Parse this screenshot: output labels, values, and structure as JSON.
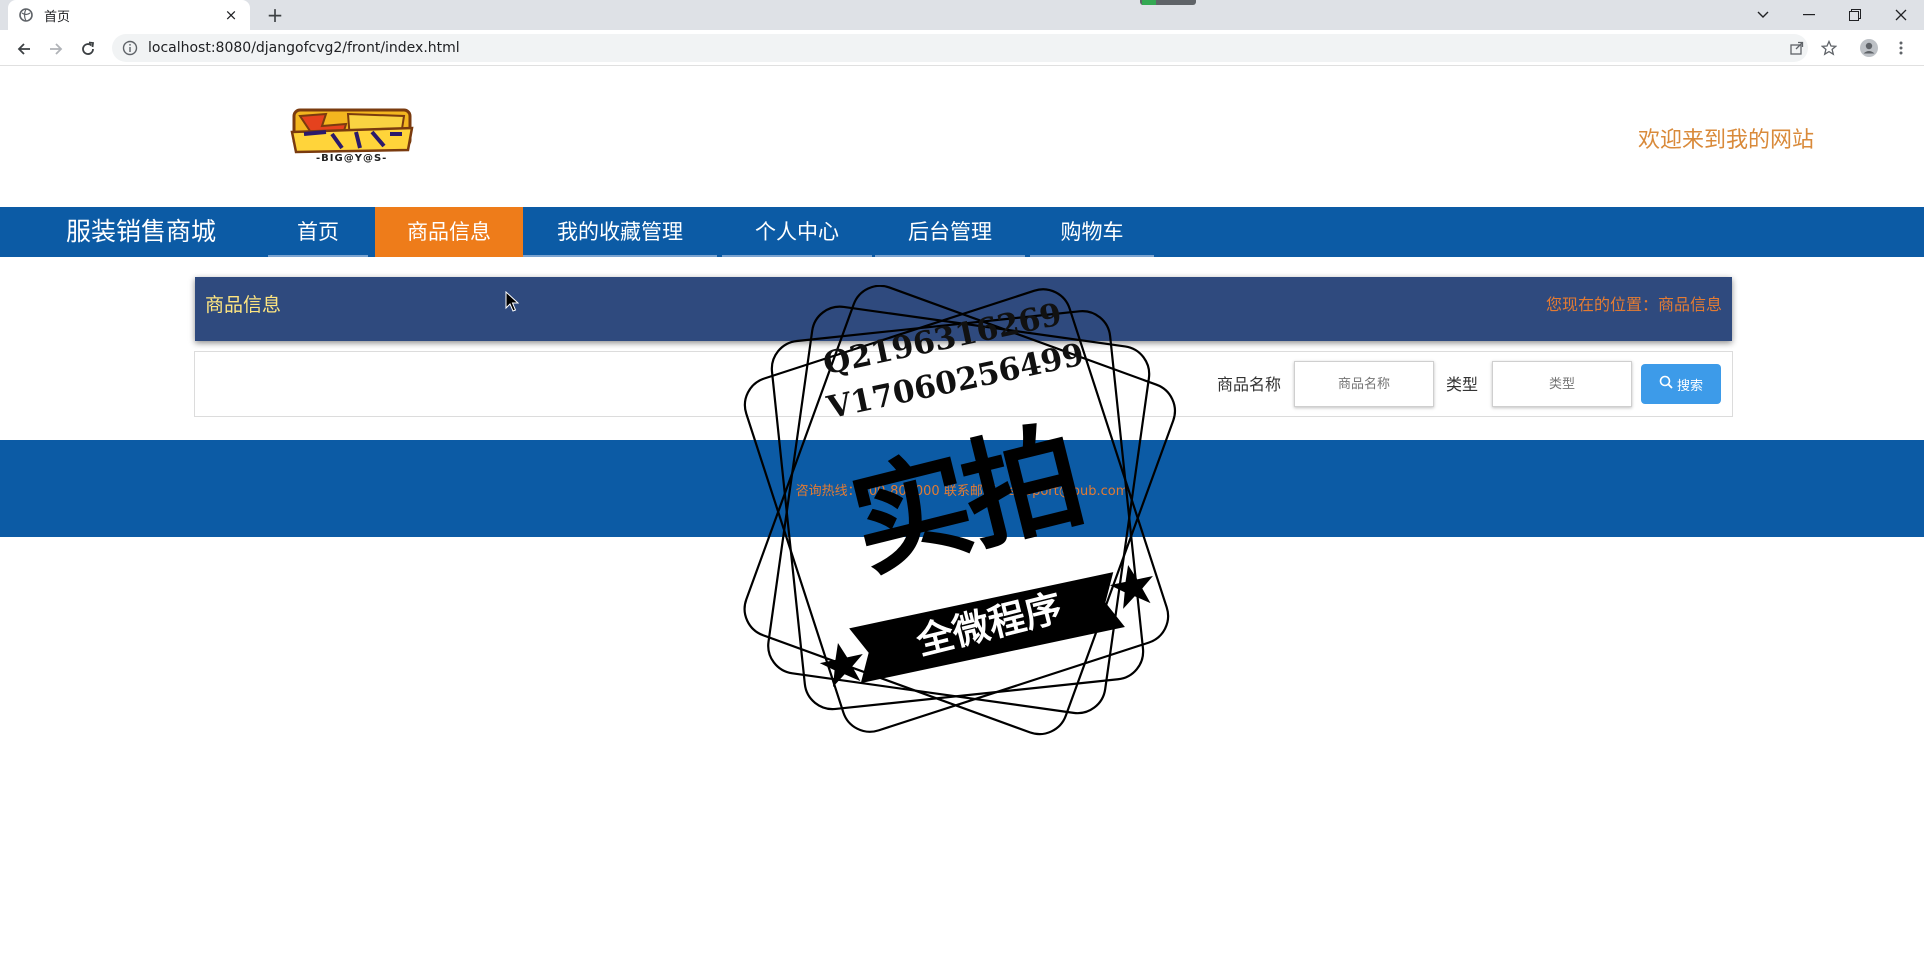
{
  "browser": {
    "tab_title": "首页",
    "url": "localhost:8080/djangofcvg2/front/index.html",
    "tab_close": "×",
    "new_tab": "+"
  },
  "header": {
    "logo_text": "-BIG@Y@S-",
    "welcome": "欢迎来到我的网站"
  },
  "nav": {
    "brand": "服装销售商城",
    "items": [
      {
        "label": "首页",
        "active": false
      },
      {
        "label": "商品信息",
        "active": true
      },
      {
        "label": "我的收藏管理",
        "active": false
      },
      {
        "label": "个人中心",
        "active": false
      },
      {
        "label": "后台管理",
        "active": false
      },
      {
        "label": "购物车",
        "active": false
      }
    ]
  },
  "crumb": {
    "title": "商品信息",
    "location": "您现在的位置：商品信息"
  },
  "search": {
    "name_label": "商品名称",
    "name_placeholder": "商品名称",
    "type_label": "类型",
    "type_placeholder": "类型",
    "button_label": "搜索"
  },
  "footer": {
    "contact": "咨询热线：400-800000  联系邮箱：support@pub.com"
  },
  "watermark": {
    "line1": "Q2196316269",
    "line2": "V17060256499",
    "main": "实拍",
    "ribbon": "全微程序"
  },
  "colors": {
    "nav_bg": "#0c5ba5",
    "nav_active": "#ee7c1a",
    "crumb_bg": "#2f4a7e",
    "accent_orange": "#e37b33",
    "button_blue": "#3d9be9"
  }
}
